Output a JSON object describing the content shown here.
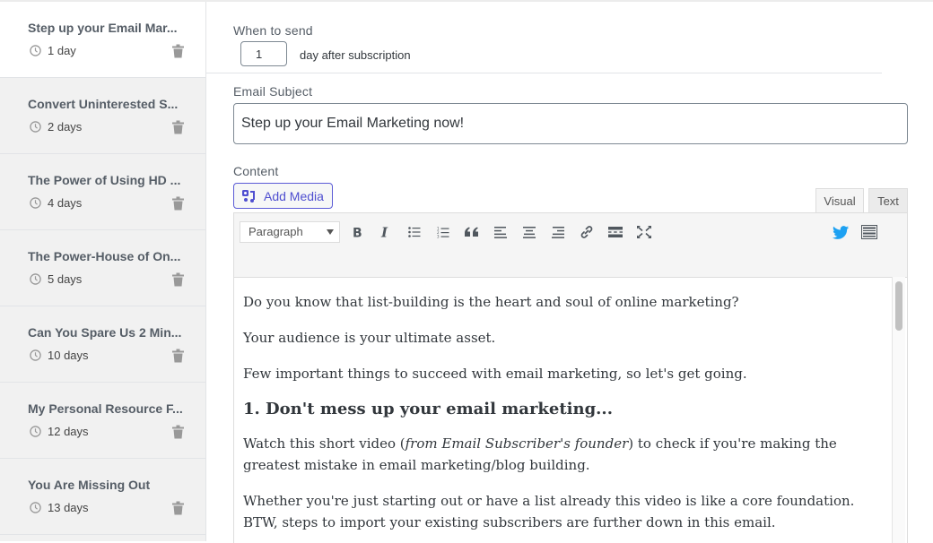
{
  "sidebar": {
    "items": [
      {
        "title": "Step up your Email Mar...",
        "delay": "1 day",
        "active": true
      },
      {
        "title": "Convert Uninterested S...",
        "delay": "2 days",
        "active": false
      },
      {
        "title": "The Power of Using HD ...",
        "delay": "4 days",
        "active": false
      },
      {
        "title": "The Power-House of On...",
        "delay": "5 days",
        "active": false
      },
      {
        "title": "Can You Spare Us 2 Min...",
        "delay": "10 days",
        "active": false
      },
      {
        "title": "My Personal Resource F...",
        "delay": "12 days",
        "active": false
      },
      {
        "title": "You Are Missing Out",
        "delay": "13 days",
        "active": false
      }
    ]
  },
  "form": {
    "when_label": "When to send",
    "days_value": "1",
    "days_suffix": "day after subscription",
    "subject_label": "Email Subject",
    "subject_value": "Step up your Email Marketing now!",
    "content_label": "Content",
    "add_media_label": "Add Media"
  },
  "editor": {
    "tabs": {
      "visual": "Visual",
      "text": "Text"
    },
    "format_select": "Paragraph",
    "twitter_color": "#1da1f2",
    "accent_color": "#4f4fd0",
    "paragraphs": [
      "Do you know that list-building is the heart and soul of online marketing?",
      "Your audience is your ultimate asset.",
      "Few important things to succeed with email marketing, so let's get going."
    ],
    "heading": "1. Don't mess up your email marketing...",
    "p4_before": "Watch this short video (",
    "p4_italic": "from Email Subscriber's founder",
    "p4_after": ") to check if you're making the greatest mistake in email marketing/blog building.",
    "p5": "Whether you're just starting out or have a list already this video is like a core foundation. BTW, steps to import your existing subscribers are further down in this email."
  }
}
